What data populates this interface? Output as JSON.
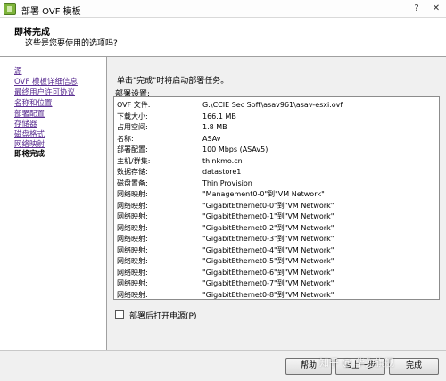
{
  "window": {
    "title": "部署 OVF 模板",
    "help_button": "?",
    "close_button": "✕"
  },
  "header": {
    "title": "即将完成",
    "subtitle": "这些是您要使用的选项吗?"
  },
  "sidebar": {
    "items": [
      {
        "label": "源",
        "current": false
      },
      {
        "label": "OVF 模板详细信息",
        "current": false
      },
      {
        "label": "最终用户许可协议",
        "current": false
      },
      {
        "label": "名称和位置",
        "current": false
      },
      {
        "label": "部署配置",
        "current": false
      },
      {
        "label": "存储器",
        "current": false
      },
      {
        "label": "磁盘格式",
        "current": false
      },
      {
        "label": "网络映射",
        "current": false
      },
      {
        "label": "即将完成",
        "current": true
      }
    ]
  },
  "main": {
    "instruction": "单击\"完成\"时将启动部署任务。",
    "settings_label": "部署设置:",
    "settings": [
      {
        "key": "OVF 文件:",
        "value": "G:\\CCIE Sec Soft\\asav961\\asav-esxi.ovf"
      },
      {
        "key": "下载大小:",
        "value": "166.1 MB"
      },
      {
        "key": "占用空间:",
        "value": "1.8 MB"
      },
      {
        "key": "名称:",
        "value": "ASAv"
      },
      {
        "key": "部署配置:",
        "value": "100 Mbps (ASAv5)"
      },
      {
        "key": "主机/群集:",
        "value": "thinkmo.cn"
      },
      {
        "key": "数据存储:",
        "value": "datastore1"
      },
      {
        "key": "磁盘置备:",
        "value": "Thin Provision"
      },
      {
        "key": "网络映射:",
        "value": "\"Management0-0\"到\"VM Network\""
      },
      {
        "key": "网络映射:",
        "value": "\"GigabitEthernet0-0\"到\"VM Network\""
      },
      {
        "key": "网络映射:",
        "value": "\"GigabitEthernet0-1\"到\"VM Network\""
      },
      {
        "key": "网络映射:",
        "value": "\"GigabitEthernet0-2\"到\"VM Network\""
      },
      {
        "key": "网络映射:",
        "value": "\"GigabitEthernet0-3\"到\"VM Network\""
      },
      {
        "key": "网络映射:",
        "value": "\"GigabitEthernet0-4\"到\"VM Network\""
      },
      {
        "key": "网络映射:",
        "value": "\"GigabitEthernet0-5\"到\"VM Network\""
      },
      {
        "key": "网络映射:",
        "value": "\"GigabitEthernet0-6\"到\"VM Network\""
      },
      {
        "key": "网络映射:",
        "value": "\"GigabitEthernet0-7\"到\"VM Network\""
      },
      {
        "key": "网络映射:",
        "value": "\"GigabitEthernet0-8\"到\"VM Network\""
      }
    ],
    "power_on_label": "部署后打开电源(P)",
    "power_on_checked": false
  },
  "footer": {
    "help_label": "帮助",
    "back_label": "≤上一步",
    "finish_label": "完成",
    "watermark": "知乎 @ 华为旗舰"
  },
  "icons": {
    "app_icon": "vsphere-app-icon",
    "checkbox": "unchecked-checkbox"
  }
}
